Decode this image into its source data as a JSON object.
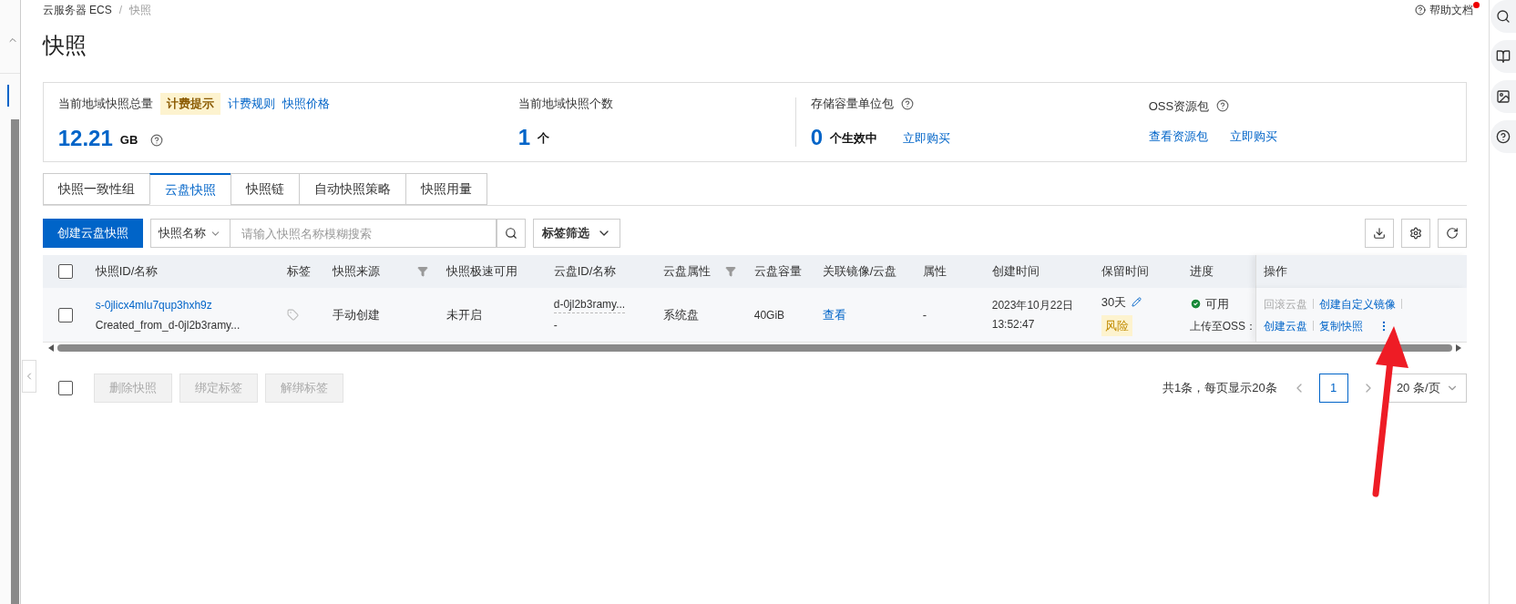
{
  "breadcrumb": [
    {
      "label": "云服务器 ECS",
      "current": false
    },
    {
      "label": "快照",
      "current": true
    }
  ],
  "breadcrumb_separator": "/",
  "help": {
    "label": "帮助文档",
    "notification": true
  },
  "title": "快照",
  "summary": [
    {
      "label": "当前地域快照总量",
      "tag": "计费提示",
      "header_links": [
        "计费规则",
        "快照价格"
      ],
      "value": "12.21",
      "unit": "GB",
      "value_help": true
    },
    {
      "label": "当前地域快照个数",
      "value": "1",
      "unit": "个"
    },
    {
      "label": "存储容量单位包",
      "label_help": true,
      "value": "0",
      "unit": "个生效中",
      "links": [
        "立即购买"
      ]
    },
    {
      "label": "OSS资源包",
      "label_help": true,
      "links": [
        "查看资源包",
        "立即购买"
      ]
    }
  ],
  "tabs": [
    {
      "label": "快照一致性组",
      "selected": false
    },
    {
      "label": "云盘快照",
      "selected": true
    },
    {
      "label": "快照链",
      "selected": false
    },
    {
      "label": "自动快照策略",
      "selected": false
    },
    {
      "label": "快照用量",
      "selected": false
    }
  ],
  "toolbar": {
    "create_button": "创建云盘快照",
    "search_field": "快照名称",
    "placeholder": "请输入快照名称模糊搜索",
    "tag_filter": "标签筛选"
  },
  "table": {
    "all_checked": false,
    "columns": [
      {
        "label": "快照ID/名称",
        "filter": false
      },
      {
        "label": "标签",
        "filter": false
      },
      {
        "label": "快照来源",
        "filter": true
      },
      {
        "label": "快照极速可用",
        "filter": false
      },
      {
        "label": "云盘ID/名称",
        "filter": false
      },
      {
        "label": "云盘属性",
        "filter": true
      },
      {
        "label": "云盘容量",
        "filter": false
      },
      {
        "label": "关联镜像/云盘",
        "filter": false
      },
      {
        "label": "属性",
        "filter": false
      },
      {
        "label": "创建时间",
        "filter": false
      },
      {
        "label": "保留时间",
        "filter": false
      },
      {
        "label": "进度",
        "filter": false
      },
      {
        "label": "操作",
        "filter": false
      }
    ],
    "rows": [
      {
        "checked": false,
        "id": "s-0jlicx4mlu7qup3hxh9z",
        "name": "Created_from_d-0jl2b3ramy...",
        "source": "手动创建",
        "fast_available": "未开启",
        "disk_id": "d-0jl2b3ramy...",
        "disk_name": "-",
        "disk_type": "系统盘",
        "capacity": "40GiB",
        "linked": "查看",
        "attribute": "-",
        "created": [
          "2023年10月22日",
          "13:52:47"
        ],
        "retention": "30天",
        "risk": "风险",
        "status": {
          "label": "可用",
          "ok": true
        },
        "upload": "上传至OSS：",
        "action_rows": [
          [
            {
              "label": "回滚云盘",
              "disabled": true
            },
            {
              "label": "创建自定义镜像",
              "disabled": false
            }
          ],
          [
            {
              "label": "创建云盘",
              "disabled": false
            },
            {
              "label": "复制快照",
              "disabled": false
            }
          ]
        ]
      }
    ]
  },
  "footer": {
    "all_checked": false,
    "buttons": [
      {
        "label": "删除快照",
        "disabled": true
      },
      {
        "label": "绑定标签",
        "disabled": true
      },
      {
        "label": "解绑标签",
        "disabled": true
      }
    ],
    "total": "共1条，每页显示20条",
    "pages": [
      {
        "label": "1",
        "selected": true
      }
    ],
    "page_size": "20 条/页"
  },
  "annotations": [
    {
      "kind": "arrow"
    }
  ]
}
